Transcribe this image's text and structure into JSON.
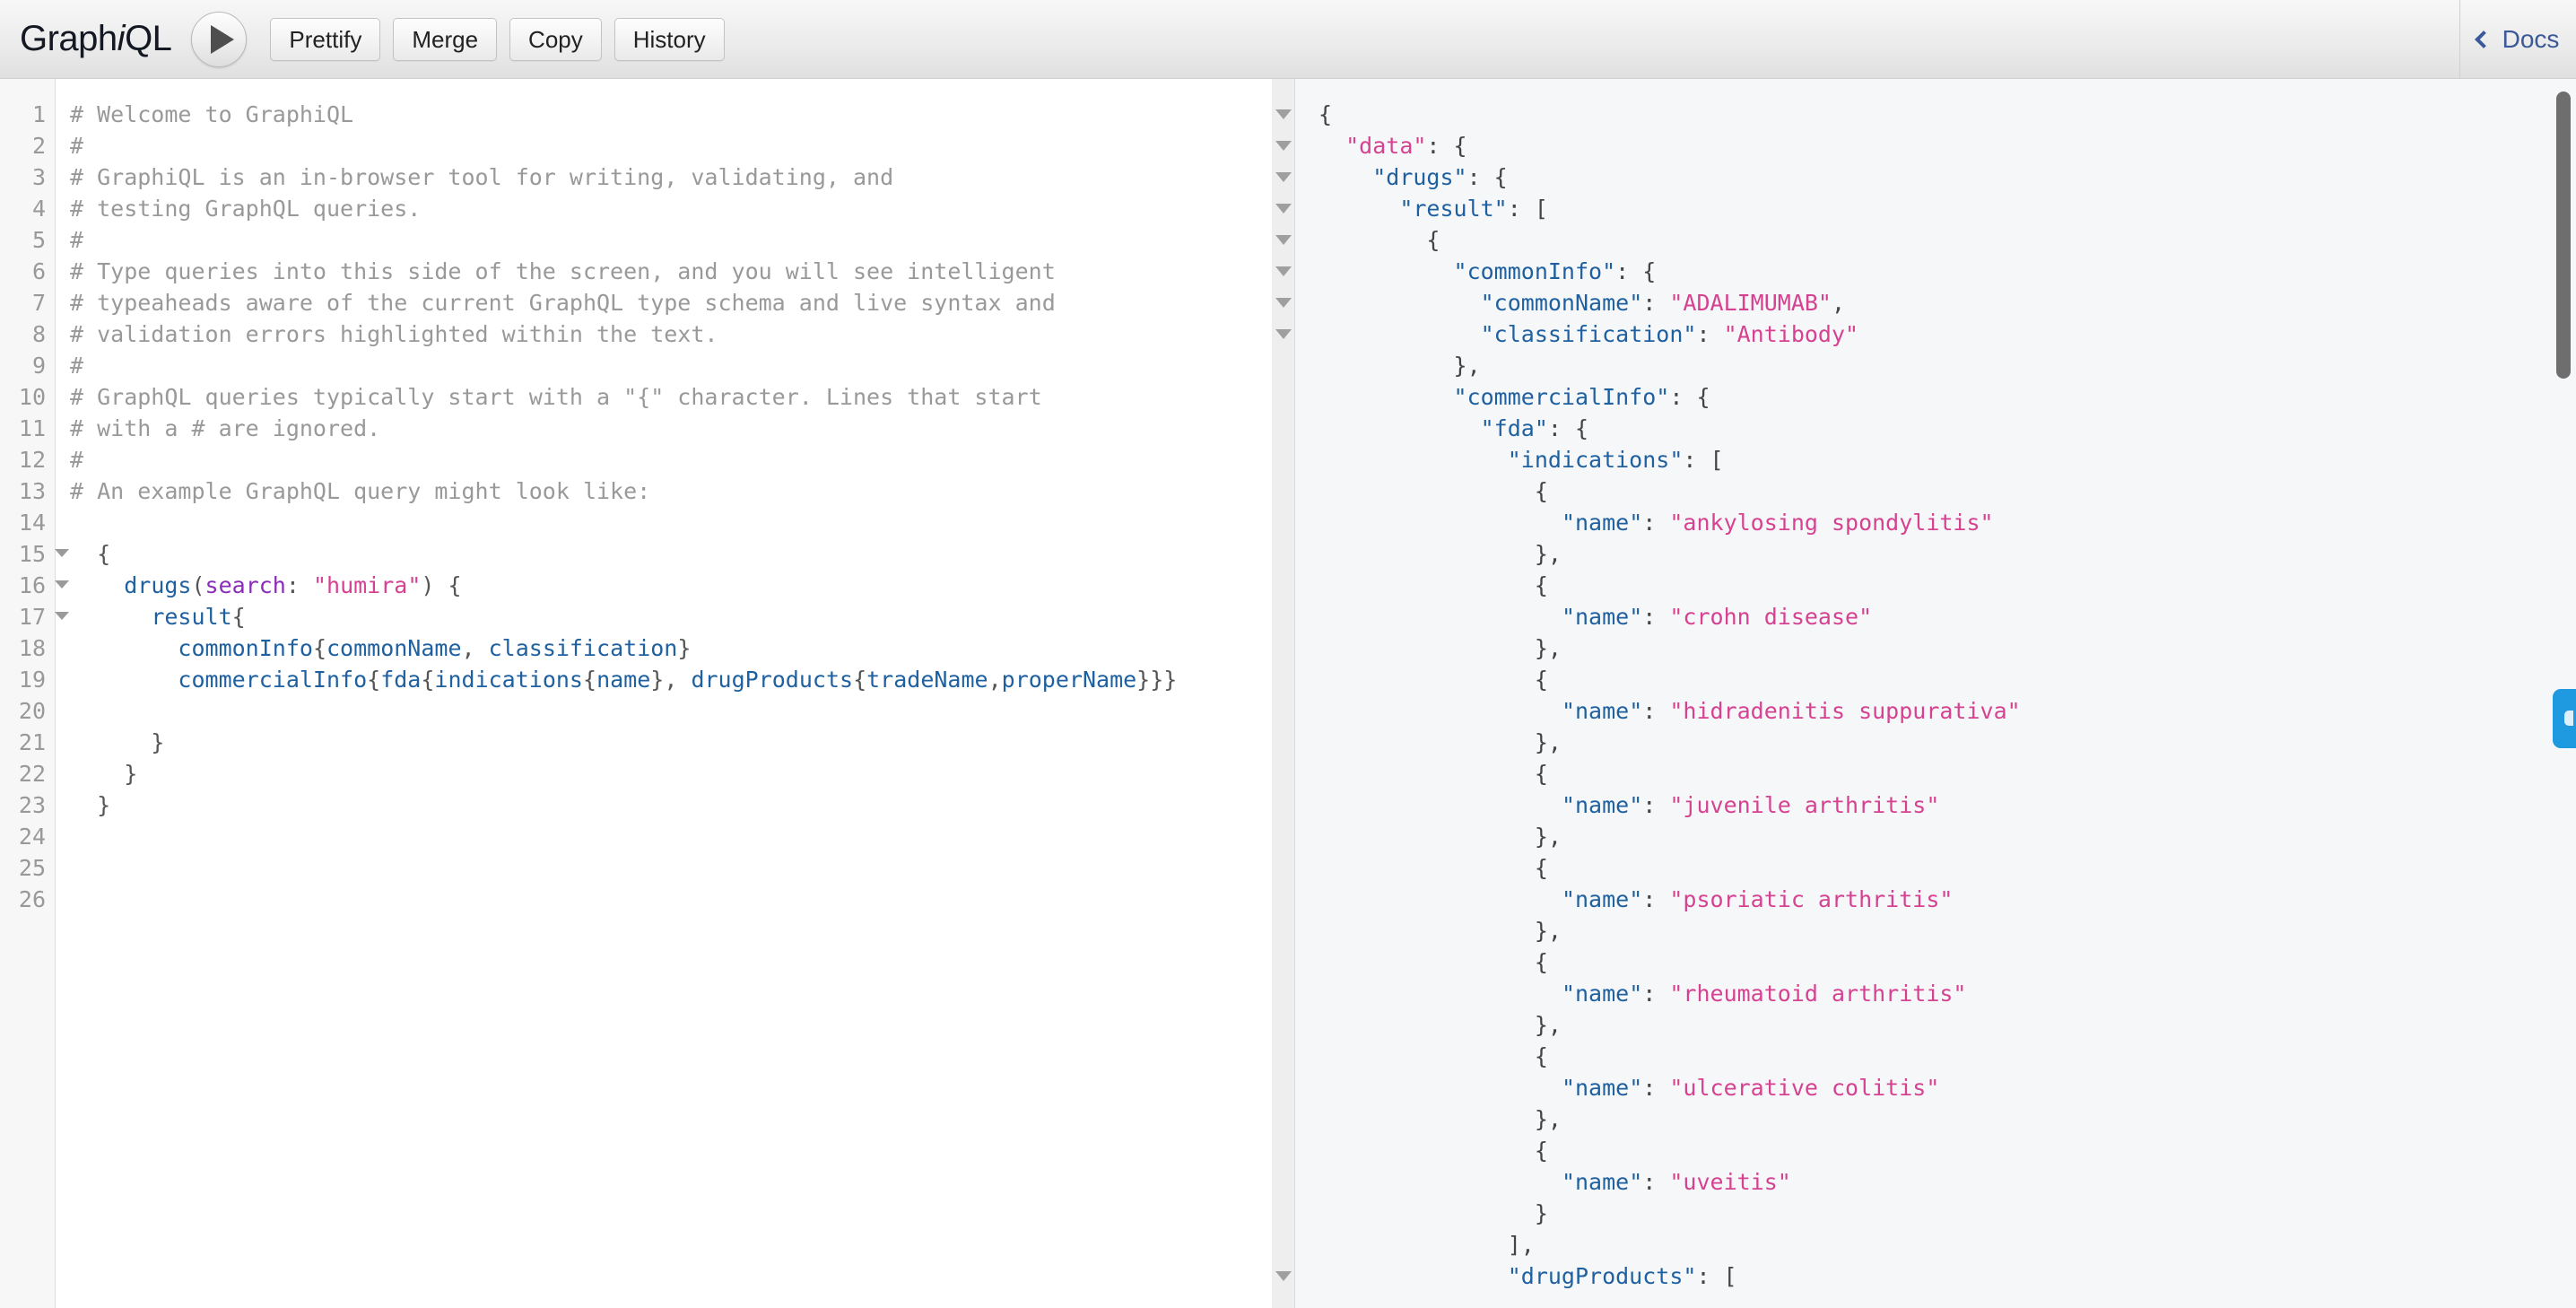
{
  "app": {
    "brand_prefix": "Graph",
    "brand_italic": "i",
    "brand_suffix": "QL",
    "title": "GraphiQL"
  },
  "toolbar": {
    "execute_label": "execute-query",
    "prettify_label": "Prettify",
    "merge_label": "Merge",
    "copy_label": "Copy",
    "history_label": "History",
    "docs_label": "Docs",
    "docs_chevron": "chevron-left-icon",
    "play_icon": "play-icon"
  },
  "query_editor": {
    "line_count": 26,
    "fold_lines": [
      15,
      16,
      17
    ],
    "line_numbers": [
      1,
      2,
      3,
      4,
      5,
      6,
      7,
      8,
      9,
      10,
      11,
      12,
      13,
      14,
      15,
      16,
      17,
      18,
      19,
      20,
      21,
      22,
      23,
      24,
      25,
      26
    ],
    "lines": [
      {
        "n": 1,
        "tokens": [
          {
            "t": "comment",
            "v": "# Welcome to GraphiQL"
          }
        ]
      },
      {
        "n": 2,
        "tokens": [
          {
            "t": "comment",
            "v": "#"
          }
        ]
      },
      {
        "n": 3,
        "tokens": [
          {
            "t": "comment",
            "v": "# GraphiQL is an in-browser tool for writing, validating, and"
          }
        ]
      },
      {
        "n": 4,
        "tokens": [
          {
            "t": "comment",
            "v": "# testing GraphQL queries."
          }
        ]
      },
      {
        "n": 5,
        "tokens": [
          {
            "t": "comment",
            "v": "#"
          }
        ]
      },
      {
        "n": 6,
        "tokens": [
          {
            "t": "comment",
            "v": "# Type queries into this side of the screen, and you will see intelligent"
          }
        ]
      },
      {
        "n": 7,
        "tokens": [
          {
            "t": "comment",
            "v": "# typeaheads aware of the current GraphQL type schema and live syntax and"
          }
        ]
      },
      {
        "n": 8,
        "tokens": [
          {
            "t": "comment",
            "v": "# validation errors highlighted within the text."
          }
        ]
      },
      {
        "n": 9,
        "tokens": [
          {
            "t": "comment",
            "v": "#"
          }
        ]
      },
      {
        "n": 10,
        "tokens": [
          {
            "t": "comment",
            "v": "# GraphQL queries typically start with a \"{\" character. Lines that start"
          }
        ]
      },
      {
        "n": 11,
        "tokens": [
          {
            "t": "comment",
            "v": "# with a # are ignored."
          }
        ]
      },
      {
        "n": 12,
        "tokens": [
          {
            "t": "comment",
            "v": "#"
          }
        ]
      },
      {
        "n": 13,
        "tokens": [
          {
            "t": "comment",
            "v": "# An example GraphQL query might look like:"
          }
        ]
      },
      {
        "n": 14,
        "tokens": [
          {
            "t": "plain",
            "v": ""
          }
        ]
      },
      {
        "n": 15,
        "tokens": [
          {
            "t": "punct",
            "v": "  {"
          }
        ]
      },
      {
        "n": 16,
        "tokens": [
          {
            "t": "plain",
            "v": "    "
          },
          {
            "t": "field",
            "v": "drugs"
          },
          {
            "t": "punct",
            "v": "("
          },
          {
            "t": "attr",
            "v": "search"
          },
          {
            "t": "punct",
            "v": ": "
          },
          {
            "t": "string",
            "v": "\"humira\""
          },
          {
            "t": "punct",
            "v": ") {"
          }
        ]
      },
      {
        "n": 17,
        "tokens": [
          {
            "t": "plain",
            "v": "      "
          },
          {
            "t": "field",
            "v": "result"
          },
          {
            "t": "punct",
            "v": "{"
          }
        ]
      },
      {
        "n": 18,
        "tokens": [
          {
            "t": "plain",
            "v": "        "
          },
          {
            "t": "field",
            "v": "commonInfo"
          },
          {
            "t": "punct",
            "v": "{"
          },
          {
            "t": "field",
            "v": "commonName"
          },
          {
            "t": "punct",
            "v": ", "
          },
          {
            "t": "field",
            "v": "classification"
          },
          {
            "t": "punct",
            "v": "}"
          }
        ]
      },
      {
        "n": 19,
        "tokens": [
          {
            "t": "plain",
            "v": "        "
          },
          {
            "t": "field",
            "v": "commercialInfo"
          },
          {
            "t": "punct",
            "v": "{"
          },
          {
            "t": "field",
            "v": "fda"
          },
          {
            "t": "punct",
            "v": "{"
          },
          {
            "t": "field",
            "v": "indications"
          },
          {
            "t": "punct",
            "v": "{"
          },
          {
            "t": "field",
            "v": "name"
          },
          {
            "t": "punct",
            "v": "}, "
          },
          {
            "t": "field",
            "v": "drugProducts"
          },
          {
            "t": "punct",
            "v": "{"
          },
          {
            "t": "field",
            "v": "tradeName"
          },
          {
            "t": "punct",
            "v": ","
          },
          {
            "t": "field",
            "v": "properName"
          },
          {
            "t": "punct",
            "v": "}}}"
          }
        ]
      },
      {
        "n": 20,
        "tokens": [
          {
            "t": "plain",
            "v": ""
          }
        ]
      },
      {
        "n": 21,
        "tokens": [
          {
            "t": "punct",
            "v": "      }"
          }
        ]
      },
      {
        "n": 22,
        "tokens": [
          {
            "t": "punct",
            "v": "    }"
          }
        ]
      },
      {
        "n": 23,
        "tokens": [
          {
            "t": "punct",
            "v": "  }"
          }
        ]
      },
      {
        "n": 24,
        "tokens": [
          {
            "t": "plain",
            "v": ""
          }
        ]
      },
      {
        "n": 25,
        "tokens": [
          {
            "t": "plain",
            "v": ""
          }
        ]
      },
      {
        "n": 26,
        "tokens": [
          {
            "t": "plain",
            "v": ""
          }
        ]
      }
    ]
  },
  "result_viewer": {
    "fold_rows": [
      1,
      2,
      3,
      4,
      5,
      6,
      7,
      8,
      38
    ],
    "lines": [
      {
        "tokens": [
          {
            "t": "punct",
            "v": "{"
          }
        ]
      },
      {
        "tokens": [
          {
            "t": "plain",
            "v": "  "
          },
          {
            "t": "key-root",
            "v": "\"data\""
          },
          {
            "t": "punct",
            "v": ": {"
          }
        ]
      },
      {
        "tokens": [
          {
            "t": "plain",
            "v": "    "
          },
          {
            "t": "key",
            "v": "\"drugs\""
          },
          {
            "t": "punct",
            "v": ": {"
          }
        ]
      },
      {
        "tokens": [
          {
            "t": "plain",
            "v": "      "
          },
          {
            "t": "key",
            "v": "\"result\""
          },
          {
            "t": "punct",
            "v": ": ["
          }
        ]
      },
      {
        "tokens": [
          {
            "t": "punct",
            "v": "        {"
          }
        ]
      },
      {
        "tokens": [
          {
            "t": "plain",
            "v": "          "
          },
          {
            "t": "key",
            "v": "\"commonInfo\""
          },
          {
            "t": "punct",
            "v": ": {"
          }
        ]
      },
      {
        "tokens": [
          {
            "t": "plain",
            "v": "            "
          },
          {
            "t": "key",
            "v": "\"commonName\""
          },
          {
            "t": "punct",
            "v": ": "
          },
          {
            "t": "string",
            "v": "\"ADALIMUMAB\""
          },
          {
            "t": "punct",
            "v": ","
          }
        ]
      },
      {
        "tokens": [
          {
            "t": "plain",
            "v": "            "
          },
          {
            "t": "key",
            "v": "\"classification\""
          },
          {
            "t": "punct",
            "v": ": "
          },
          {
            "t": "string",
            "v": "\"Antibody\""
          }
        ]
      },
      {
        "tokens": [
          {
            "t": "punct",
            "v": "          },"
          }
        ]
      },
      {
        "tokens": [
          {
            "t": "plain",
            "v": "          "
          },
          {
            "t": "key",
            "v": "\"commercialInfo\""
          },
          {
            "t": "punct",
            "v": ": {"
          }
        ]
      },
      {
        "tokens": [
          {
            "t": "plain",
            "v": "            "
          },
          {
            "t": "key",
            "v": "\"fda\""
          },
          {
            "t": "punct",
            "v": ": {"
          }
        ]
      },
      {
        "tokens": [
          {
            "t": "plain",
            "v": "              "
          },
          {
            "t": "key",
            "v": "\"indications\""
          },
          {
            "t": "punct",
            "v": ": ["
          }
        ]
      },
      {
        "tokens": [
          {
            "t": "punct",
            "v": "                {"
          }
        ]
      },
      {
        "tokens": [
          {
            "t": "plain",
            "v": "                  "
          },
          {
            "t": "key",
            "v": "\"name\""
          },
          {
            "t": "punct",
            "v": ": "
          },
          {
            "t": "string",
            "v": "\"ankylosing spondylitis\""
          }
        ]
      },
      {
        "tokens": [
          {
            "t": "punct",
            "v": "                },"
          }
        ]
      },
      {
        "tokens": [
          {
            "t": "punct",
            "v": "                {"
          }
        ]
      },
      {
        "tokens": [
          {
            "t": "plain",
            "v": "                  "
          },
          {
            "t": "key",
            "v": "\"name\""
          },
          {
            "t": "punct",
            "v": ": "
          },
          {
            "t": "string",
            "v": "\"crohn disease\""
          }
        ]
      },
      {
        "tokens": [
          {
            "t": "punct",
            "v": "                },"
          }
        ]
      },
      {
        "tokens": [
          {
            "t": "punct",
            "v": "                {"
          }
        ]
      },
      {
        "tokens": [
          {
            "t": "plain",
            "v": "                  "
          },
          {
            "t": "key",
            "v": "\"name\""
          },
          {
            "t": "punct",
            "v": ": "
          },
          {
            "t": "string",
            "v": "\"hidradenitis suppurativa\""
          }
        ]
      },
      {
        "tokens": [
          {
            "t": "punct",
            "v": "                },"
          }
        ]
      },
      {
        "tokens": [
          {
            "t": "punct",
            "v": "                {"
          }
        ]
      },
      {
        "tokens": [
          {
            "t": "plain",
            "v": "                  "
          },
          {
            "t": "key",
            "v": "\"name\""
          },
          {
            "t": "punct",
            "v": ": "
          },
          {
            "t": "string",
            "v": "\"juvenile arthritis\""
          }
        ]
      },
      {
        "tokens": [
          {
            "t": "punct",
            "v": "                },"
          }
        ]
      },
      {
        "tokens": [
          {
            "t": "punct",
            "v": "                {"
          }
        ]
      },
      {
        "tokens": [
          {
            "t": "plain",
            "v": "                  "
          },
          {
            "t": "key",
            "v": "\"name\""
          },
          {
            "t": "punct",
            "v": ": "
          },
          {
            "t": "string",
            "v": "\"psoriatic arthritis\""
          }
        ]
      },
      {
        "tokens": [
          {
            "t": "punct",
            "v": "                },"
          }
        ]
      },
      {
        "tokens": [
          {
            "t": "punct",
            "v": "                {"
          }
        ]
      },
      {
        "tokens": [
          {
            "t": "plain",
            "v": "                  "
          },
          {
            "t": "key",
            "v": "\"name\""
          },
          {
            "t": "punct",
            "v": ": "
          },
          {
            "t": "string",
            "v": "\"rheumatoid arthritis\""
          }
        ]
      },
      {
        "tokens": [
          {
            "t": "punct",
            "v": "                },"
          }
        ]
      },
      {
        "tokens": [
          {
            "t": "punct",
            "v": "                {"
          }
        ]
      },
      {
        "tokens": [
          {
            "t": "plain",
            "v": "                  "
          },
          {
            "t": "key",
            "v": "\"name\""
          },
          {
            "t": "punct",
            "v": ": "
          },
          {
            "t": "string",
            "v": "\"ulcerative colitis\""
          }
        ]
      },
      {
        "tokens": [
          {
            "t": "punct",
            "v": "                },"
          }
        ]
      },
      {
        "tokens": [
          {
            "t": "punct",
            "v": "                {"
          }
        ]
      },
      {
        "tokens": [
          {
            "t": "plain",
            "v": "                  "
          },
          {
            "t": "key",
            "v": "\"name\""
          },
          {
            "t": "punct",
            "v": ": "
          },
          {
            "t": "string",
            "v": "\"uveitis\""
          }
        ]
      },
      {
        "tokens": [
          {
            "t": "punct",
            "v": "                }"
          }
        ]
      },
      {
        "tokens": [
          {
            "t": "punct",
            "v": "              ],"
          }
        ]
      },
      {
        "tokens": [
          {
            "t": "plain",
            "v": "              "
          },
          {
            "t": "key",
            "v": "\"drugProducts\""
          },
          {
            "t": "punct",
            "v": ": ["
          }
        ]
      }
    ]
  },
  "scrollbar": {
    "name": "result-scrollbar"
  },
  "side_handle": {
    "name": "side-drawer-handle",
    "color": "#1f9ae0"
  },
  "colors": {
    "field_blue": "#1f61a0",
    "string_pink": "#d64292",
    "attr_purple": "#8b2bb9",
    "comment_gray": "#999999",
    "docs_blue": "#3b5998",
    "result_bg": "#f6f7f8"
  }
}
